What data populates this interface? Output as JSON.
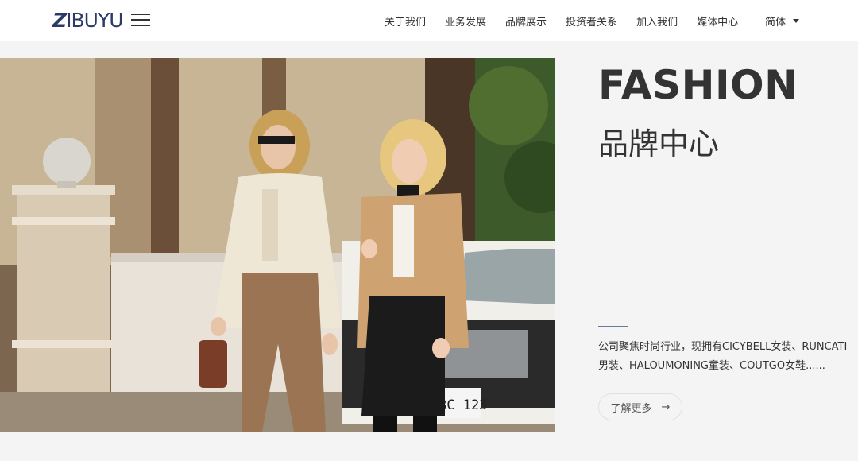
{
  "header": {
    "logo_prefix": "Z",
    "logo_rest": "IBUYU",
    "nav": [
      {
        "label": "关于我们"
      },
      {
        "label": "业务发展"
      },
      {
        "label": "品牌展示"
      },
      {
        "label": "投资者关系"
      },
      {
        "label": "加入我们"
      },
      {
        "label": "媒体中心"
      }
    ],
    "language": "简体"
  },
  "hero": {
    "title": "FASHION",
    "subtitle": "品牌中心",
    "description": "公司聚焦时尚行业，现拥有CICYBELL女装、RUNCATI男装、HALOUMONING童装、COUTGO女鞋......",
    "more_button": "了解更多",
    "more_arrow": "→",
    "license_plate": "BC 123"
  }
}
